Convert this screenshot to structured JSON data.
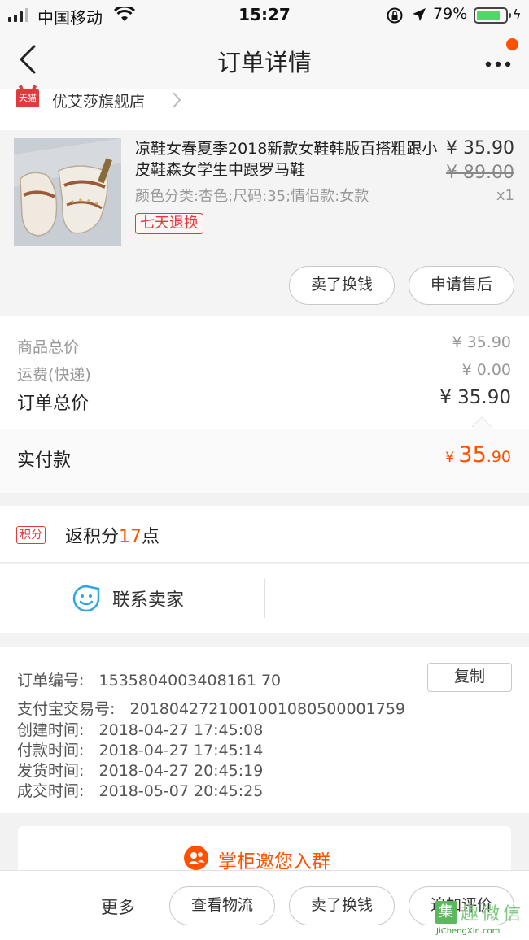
{
  "status_bar": {
    "carrier": "中国移动",
    "time": "15:27",
    "battery": "79%"
  },
  "nav": {
    "title": "订单详情"
  },
  "shop": {
    "badge": "天猫",
    "name": "优艾莎旗舰店"
  },
  "product": {
    "title": "凉鞋女春夏季2018新款女鞋韩版百搭粗跟小皮鞋森女学生中跟罗马鞋",
    "price": "¥ 35.90",
    "original_price": "¥ 89.00",
    "quantity": "x1",
    "sku": "颜色分类:杏色;尺码:35;情侣款:女款",
    "return_tag": "七天退换",
    "actions": [
      "卖了换钱",
      "申请售后"
    ]
  },
  "price_breakdown": {
    "items_label": "商品总价",
    "items_value": "¥ 35.90",
    "shipping_label": "运费(快递)",
    "shipping_value": "¥ 0.00",
    "total_label": "订单总价",
    "total_value": "¥ 35.90",
    "paid_label": "实付款",
    "paid_currency": "¥ ",
    "paid_int": "35",
    "paid_dec": ".90"
  },
  "points": {
    "tag": "积分",
    "prefix": "返积分",
    "value": "17",
    "suffix": "点"
  },
  "contact": {
    "label": "联系卖家"
  },
  "order_info": {
    "copy_label": "复制",
    "lines": [
      "订单编号:   1535804003408161 70",
      "支付宝交易号:   2018042721001001080500001759",
      "创建时间:   2018-04-27 17:45:08",
      "付款时间:   2018-04-27 17:45:14",
      "发货时间:   2018-04-27 20:45:19",
      "成交时间:   2018-05-07 20:45:25"
    ]
  },
  "invite": {
    "label": "掌柜邀您入群"
  },
  "bottom_bar": {
    "more": "更多",
    "buttons": [
      "查看物流",
      "卖了换钱",
      "追加评价"
    ]
  },
  "watermark": {
    "mark": "集",
    "title": "趣微信",
    "url": "JiChengXin.com"
  },
  "colors": {
    "accent": "#ff5000",
    "tmall_red": "#e4393c",
    "battery_green": "#4cd964"
  },
  "icons": [
    "signal-icon",
    "wifi-icon",
    "rotation-lock-icon",
    "location-icon",
    "battery-icon",
    "back-arrow-icon",
    "more-dots-icon",
    "tmall-icon",
    "chevron-right-icon",
    "contact-smile-icon",
    "group-icon"
  ]
}
